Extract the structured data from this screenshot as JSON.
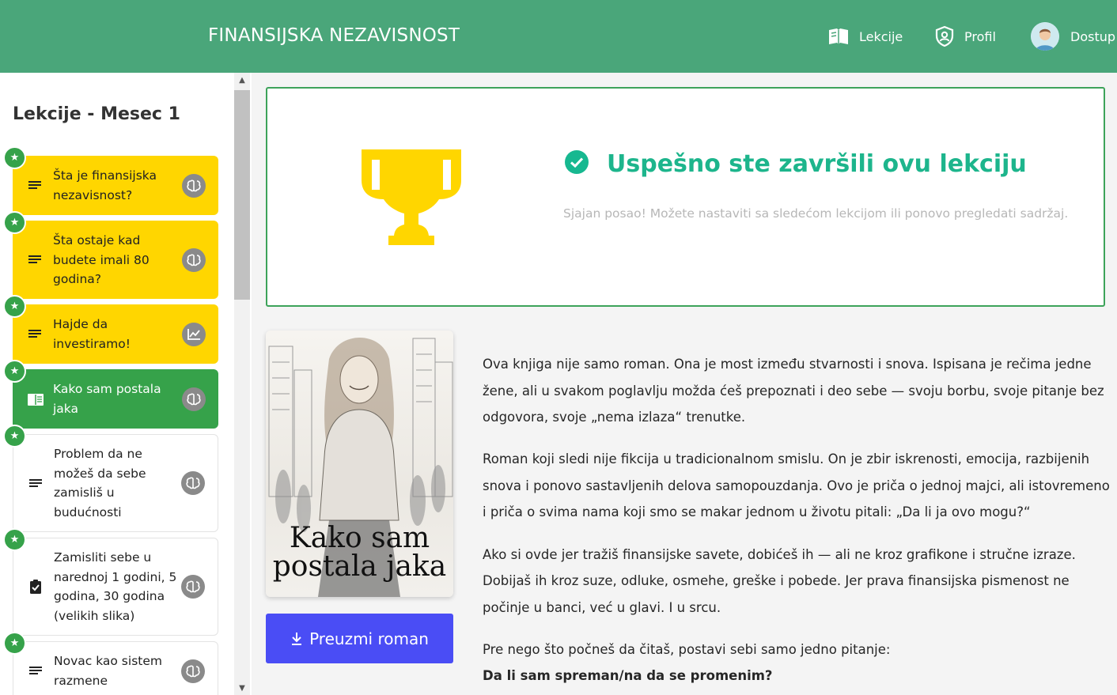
{
  "header": {
    "brand": "FINANSIJSKA NEZAVISNOST",
    "nav": {
      "lekcije": "Lekcije",
      "profil": "Profil",
      "dostup": "Dostup"
    },
    "colors": {
      "background": "#4aa67a"
    }
  },
  "sidebar": {
    "title": "Lekcije - Mesec 1",
    "lessons": [
      {
        "title": "Šta je finansijska nezavisnost?",
        "status": "completed",
        "type_icon": "text-lines-icon",
        "badge_icon": "brain-icon"
      },
      {
        "title": "Šta ostaje kad budete imali 80 godina?",
        "status": "completed",
        "type_icon": "text-lines-icon",
        "badge_icon": "brain-icon"
      },
      {
        "title": "Hajde da investiramo!",
        "status": "completed",
        "type_icon": "text-lines-icon",
        "badge_icon": "chart-icon"
      },
      {
        "title": "Kako sam postala jaka",
        "status": "active",
        "type_icon": "book-icon",
        "badge_icon": "brain-icon"
      },
      {
        "title": "Problem da ne možeš da sebe zamisliš u budućnosti",
        "status": "open",
        "type_icon": "text-lines-icon",
        "badge_icon": "brain-icon"
      },
      {
        "title": "Zamisliti sebe u narednoj 1 godini, 5 godina, 30 godina (velikih slika)",
        "status": "open",
        "type_icon": "clipboard-check-icon",
        "badge_icon": "brain-icon"
      },
      {
        "title": "Novac kao sistem razmene",
        "status": "open",
        "type_icon": "text-lines-icon",
        "badge_icon": "brain-icon"
      }
    ],
    "colors": {
      "completed": "#ffd600",
      "active": "#36a24a",
      "star": "#36a24a"
    }
  },
  "success": {
    "title": "Uspešno ste završili ovu lekciju",
    "subtitle": "Sjajan posao! Možete nastaviti sa sledećom lekcijom ili ponovo pregledati sadržaj.",
    "colors": {
      "title": "#1db58c",
      "trophy": "#ffd600",
      "border": "#3da35a"
    }
  },
  "book": {
    "cover_title_line1": "Kako sam",
    "cover_title_line2": "postala jaka",
    "download_label": "Preuzmi roman",
    "colors": {
      "button": "#4a4df5"
    }
  },
  "content": {
    "p1": "Ova knjiga nije samo roman. Ona je most između stvarnosti i snova. Ispisana je rečima jedne žene, ali u svakom poglavlju možda ćeš prepoznati i deo sebe — svoju borbu, svoje pitanje bez odgovora, svoje „nema izlaza“ trenutke.",
    "p2": "Roman koji sledi nije fikcija u tradicionalnom smislu. On je zbir iskrenosti, emocija, razbijenih snova i ponovo sastavljenih delova samopouzdanja. Ovo je priča o jednoj majci, ali istovremeno i priča o svima nama koji smo se makar jednom u životu pitali: „Da li ja ovo mogu?“",
    "p3": "Ako si ovde jer tražiš finansijske savete, dobićeš ih — ali ne kroz grafikone i stručne izraze. Dobijaš ih kroz suze, odluke, osmehe, greške i pobede. Jer prava finansijska pismenost ne počinje u banci, već u glavi. I u srcu.",
    "p4": "Pre nego što počneš da čitaš, postavi sebi samo jedno pitanje:",
    "p5": "Da li sam spreman/na da se promenim?"
  }
}
